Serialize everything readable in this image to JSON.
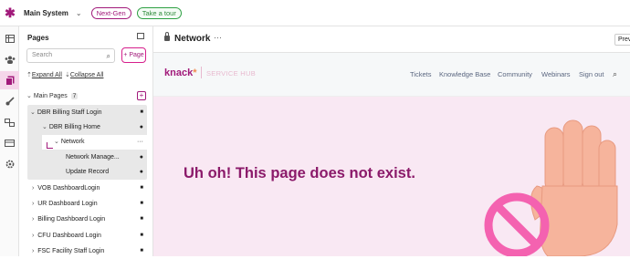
{
  "topbar": {
    "system_name": "Main System",
    "next_gen_label": "Next-Gen",
    "tour_label": "Take a tour"
  },
  "rail": {
    "icons": [
      "table-icon",
      "users-icon",
      "pages-icon",
      "brush-icon",
      "flows-icon",
      "billing-icon",
      "settings-icon"
    ],
    "active": "pages-icon"
  },
  "pages_panel": {
    "title": "Pages",
    "search_placeholder": "Search",
    "add_page_label": "+ Page",
    "expand_all": "Expand All",
    "collapse_all": "Collapse All",
    "main_pages_label": "Main Pages",
    "main_pages_count": "7",
    "items": [
      {
        "label": "DBR Billing Staff Login",
        "trailing": "lock"
      },
      {
        "label": "DBR Billing Home",
        "trailing": "dot"
      },
      {
        "label": "Network",
        "trailing": "more"
      },
      {
        "label": "Network Manage...",
        "trailing": "dot"
      },
      {
        "label": "Update Record",
        "trailing": "dot"
      },
      {
        "label": "VOB DashboardLogin",
        "trailing": "lock"
      },
      {
        "label": "UR Dashboard Login",
        "trailing": "lock"
      },
      {
        "label": "Billing Dashboard Login",
        "trailing": "lock"
      },
      {
        "label": "CFU Dashboard Login",
        "trailing": "lock"
      },
      {
        "label": "FSC Facility Staff Login",
        "trailing": "lock"
      }
    ]
  },
  "main": {
    "title": "Network",
    "more_label": "···",
    "preview_label": "Previ"
  },
  "site": {
    "brand": "knack",
    "brand_mark": "*",
    "hub_label": "SERVICE HUB",
    "nav": [
      "Tickets",
      "Knowledge Base",
      "Community",
      "Webinars",
      "Sign out"
    ],
    "error_message": "Uh oh! This page does not exist.",
    "colors": {
      "brand": "#a1197a",
      "error_bg": "#f9e8f3",
      "error_text": "#8b1a6a",
      "prohibit": "#f462b0",
      "hand": "#f6b49c"
    }
  }
}
